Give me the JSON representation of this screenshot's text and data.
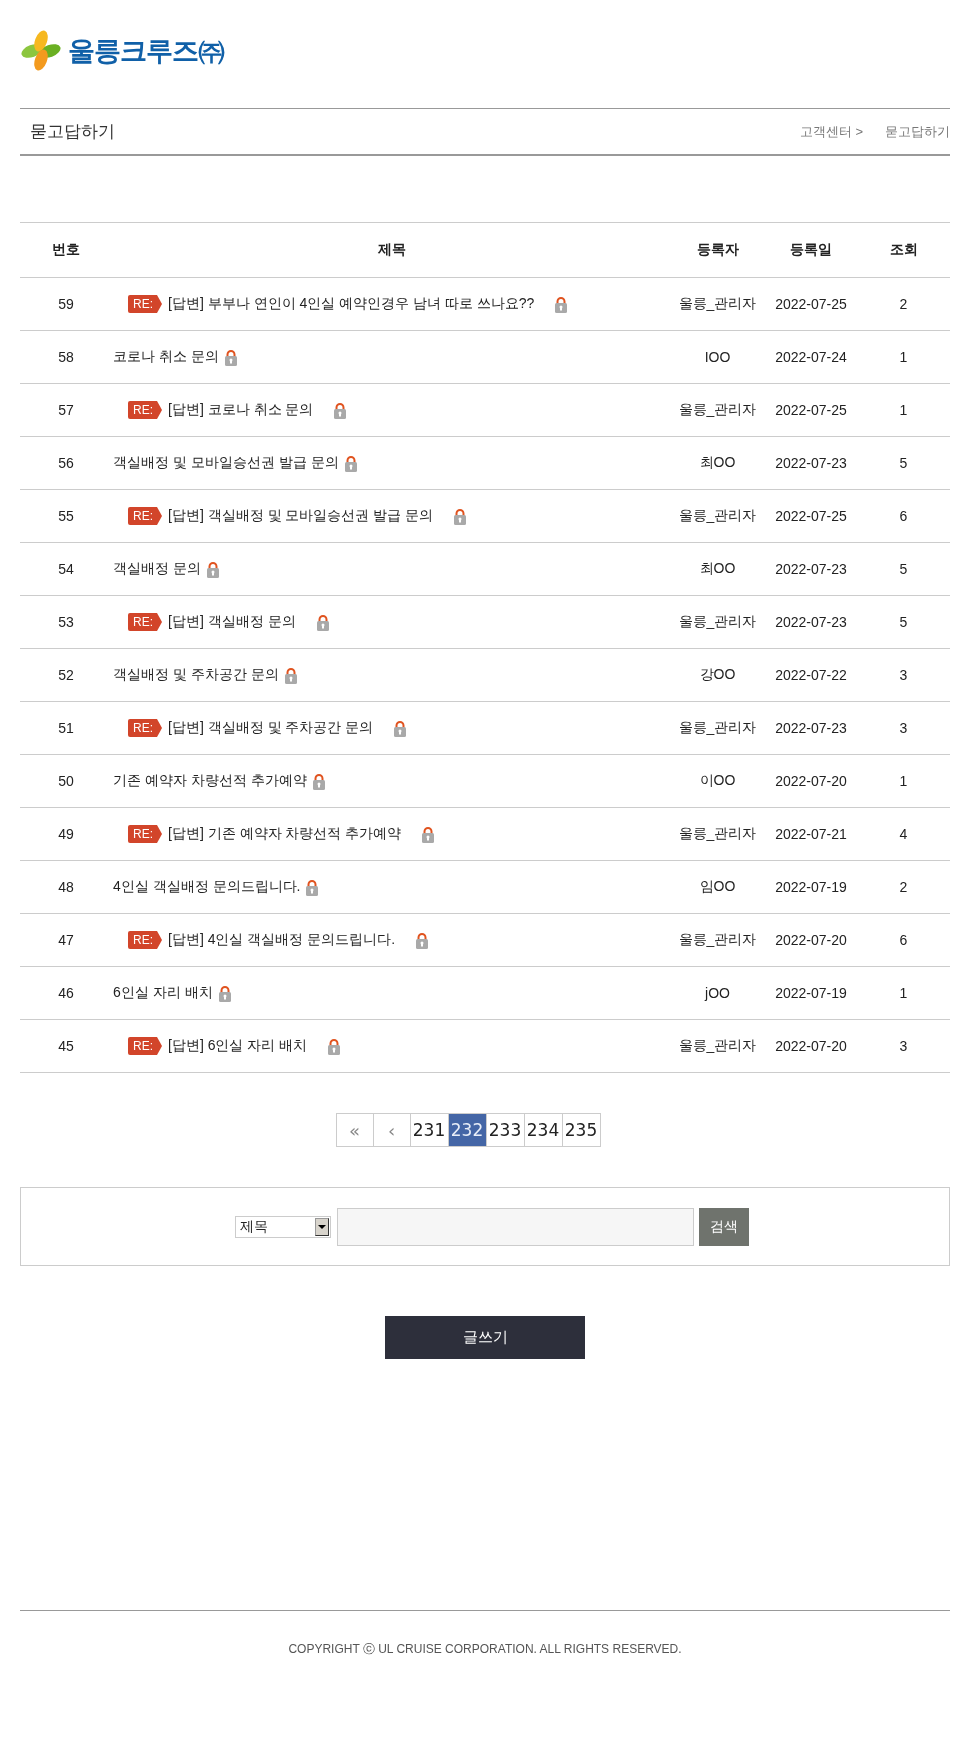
{
  "logo": {
    "text": "울릉크루즈㈜"
  },
  "page_title": "묻고답하기",
  "breadcrumb": [
    "고객센터 >",
    "묻고답하기"
  ],
  "table": {
    "columns": [
      "번호",
      "제목",
      "등록자",
      "등록일",
      "조회"
    ],
    "rows": [
      {
        "kind": "reply",
        "number": "59",
        "badge": "RE:",
        "title": "[답변] 부부나 연인이 4인실 예약인경우 남녀 따로 쓰나요??",
        "author": "울릉_관리자",
        "date": "2022-07-25",
        "views": "2"
      },
      {
        "kind": "question",
        "number": "58",
        "title": "코로나 취소 문의",
        "author": "IOO",
        "date": "2022-07-24",
        "views": "1"
      },
      {
        "kind": "reply",
        "number": "57",
        "badge": "RE:",
        "title": "[답변] 코로나 취소 문의",
        "author": "울릉_관리자",
        "date": "2022-07-25",
        "views": "1"
      },
      {
        "kind": "question",
        "number": "56",
        "title": "객실배정 및 모바일승선권 발급 문의",
        "author": "최OO",
        "date": "2022-07-23",
        "views": "5"
      },
      {
        "kind": "reply",
        "number": "55",
        "badge": "RE:",
        "title": "[답변] 객실배정 및 모바일승선권 발급 문의",
        "author": "울릉_관리자",
        "date": "2022-07-25",
        "views": "6"
      },
      {
        "kind": "question",
        "number": "54",
        "title": "객실배정 문의",
        "author": "최OO",
        "date": "2022-07-23",
        "views": "5"
      },
      {
        "kind": "reply",
        "number": "53",
        "badge": "RE:",
        "title": "[답변] 객실배정 문의",
        "author": "울릉_관리자",
        "date": "2022-07-23",
        "views": "5"
      },
      {
        "kind": "question",
        "number": "52",
        "title": "객실배정 및 주차공간 문의",
        "author": "강OO",
        "date": "2022-07-22",
        "views": "3"
      },
      {
        "kind": "reply",
        "number": "51",
        "badge": "RE:",
        "title": "[답변] 객실배정 및 주차공간 문의",
        "author": "울릉_관리자",
        "date": "2022-07-23",
        "views": "3"
      },
      {
        "kind": "question",
        "number": "50",
        "title": "기존 예약자 차량선적 추가예약",
        "author": "이OO",
        "date": "2022-07-20",
        "views": "1"
      },
      {
        "kind": "reply",
        "number": "49",
        "badge": "RE:",
        "title": "[답변] 기존 예약자 차량선적 추가예약",
        "author": "울릉_관리자",
        "date": "2022-07-21",
        "views": "4"
      },
      {
        "kind": "question",
        "number": "48",
        "title": "4인실 객실배정 문의드립니다.",
        "author": "임OO",
        "date": "2022-07-19",
        "views": "2"
      },
      {
        "kind": "reply",
        "number": "47",
        "badge": "RE:",
        "title": "[답변] 4인실 객실배정 문의드립니다.",
        "author": "울릉_관리자",
        "date": "2022-07-20",
        "views": "6"
      },
      {
        "kind": "question",
        "number": "46",
        "title": "6인실 자리 배치",
        "author": "jOO",
        "date": "2022-07-19",
        "views": "1"
      },
      {
        "kind": "reply",
        "number": "45",
        "badge": "RE:",
        "title": "[답변] 6인실 자리 배치",
        "author": "울릉_관리자",
        "date": "2022-07-20",
        "views": "3"
      }
    ]
  },
  "pagination": {
    "first": "«",
    "prev": "‹",
    "pages": [
      {
        "label": "231",
        "selected": false
      },
      {
        "label": "232",
        "selected": true
      },
      {
        "label": "233",
        "selected": false
      },
      {
        "label": "234",
        "selected": false
      },
      {
        "label": "235",
        "selected": false
      }
    ]
  },
  "search": {
    "field_select": "제목",
    "button": "검색"
  },
  "write_button": "글쓰기",
  "footer": "COPYRIGHT ⓒ UL CRUISE CORPORATION. ALL RIGHTS RESERVED."
}
